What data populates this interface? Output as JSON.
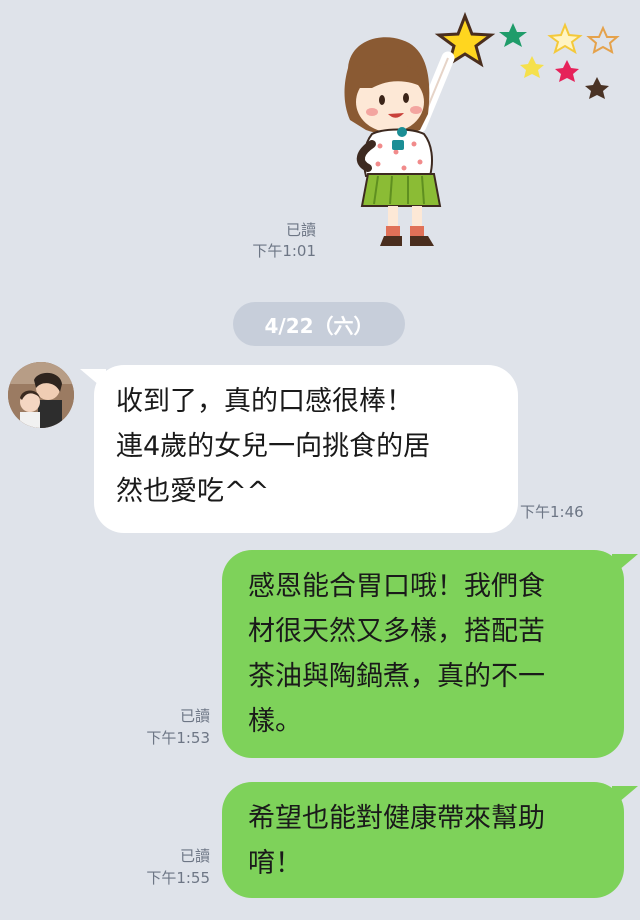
{
  "sticker_meta": {
    "read": "已讀",
    "time": "下午1:01"
  },
  "date_separator": "4/22（六）",
  "messages": [
    {
      "lines": [
        "收到了，真的口感很棒！",
        "連4歲的女兒一向挑食的居",
        "然也愛吃^^"
      ],
      "time": "下午1:46"
    },
    {
      "lines": [
        "感恩能合胃口哦！我們食",
        "材很天然又多樣，搭配苦",
        "茶油與陶鍋煮，真的不一",
        "樣。"
      ],
      "read": "已讀",
      "time": "下午1:53"
    },
    {
      "lines": [
        "希望也能對健康帶來幫助",
        "唷！"
      ],
      "read": "已讀",
      "time": "下午1:55"
    }
  ],
  "colors": {
    "background": "#dfe3ea",
    "incoming": "#ffffff",
    "outgoing": "#7ed25a",
    "date_pill": "#c7ceda"
  },
  "icons": [
    "girl-sticker-icon",
    "star-icon",
    "avatar"
  ]
}
